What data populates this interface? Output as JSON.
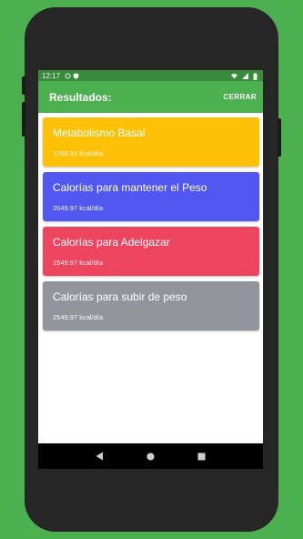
{
  "status_bar": {
    "time": "12:17",
    "icons": [
      "sync-icon",
      "shield-icon",
      "wifi-icon",
      "signal-icon",
      "battery-icon"
    ]
  },
  "app_bar": {
    "title": "Resultados:",
    "close_label": "CERRAR",
    "color": "#4cb050"
  },
  "cards": [
    {
      "title": "Metabolismo Basal",
      "value": "1708.31 kcal/día",
      "color": "#ffc107"
    },
    {
      "title": "Calorías para mantener el Peso",
      "value": "2049.97 kcal/día",
      "color": "#5257f2"
    },
    {
      "title": "Calorías para Adelgazar",
      "value": "1549.97 kcal/día",
      "color": "#ed4560"
    },
    {
      "title": "Calorías para subir de peso",
      "value": "2549.97 kcal/día",
      "color": "#92959c"
    }
  ],
  "nav_bar": {
    "buttons": [
      "back-icon",
      "home-icon",
      "recents-icon"
    ]
  }
}
